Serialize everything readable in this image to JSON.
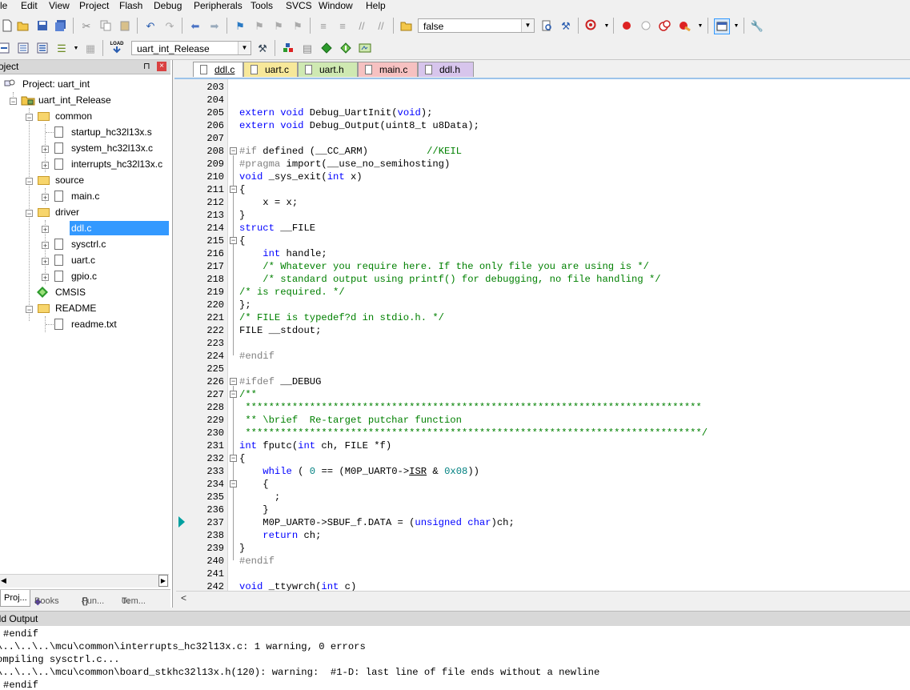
{
  "menu": [
    "le",
    "Edit",
    "View",
    "Project",
    "Flash",
    "Debug",
    "Peripherals",
    "Tools",
    "SVCS",
    "Window",
    "Help"
  ],
  "toolbar": {
    "find_value": "false",
    "target_value": "uart_int_Release",
    "load_label": "LOAD"
  },
  "project": {
    "panel_title": "oject",
    "items": [
      {
        "label": "Project: uart_int"
      },
      {
        "label": "uart_int_Release"
      },
      {
        "label": "common"
      },
      {
        "label": "startup_hc32l13x.s"
      },
      {
        "label": "system_hc32l13x.c"
      },
      {
        "label": "interrupts_hc32l13x.c"
      },
      {
        "label": "source"
      },
      {
        "label": "main.c"
      },
      {
        "label": "driver"
      },
      {
        "label": "ddl.c"
      },
      {
        "label": "sysctrl.c"
      },
      {
        "label": "uart.c"
      },
      {
        "label": "gpio.c"
      },
      {
        "label": "CMSIS"
      },
      {
        "label": "README"
      },
      {
        "label": "readme.txt"
      }
    ],
    "bottom_tabs": [
      "Proj...",
      "Books",
      "Fun...",
      "Tem..."
    ]
  },
  "editor": {
    "tabs": [
      {
        "label": "ddl.c",
        "color": "#ffffff"
      },
      {
        "label": "uart.c",
        "color": "#f7e89a"
      },
      {
        "label": "uart.h",
        "color": "#cfe9b2"
      },
      {
        "label": "main.c",
        "color": "#f6c1c1"
      },
      {
        "label": "ddl.h",
        "color": "#d7c5ec"
      }
    ],
    "line_numbers": [
      "203",
      "204",
      "205",
      "206",
      "207",
      "208",
      "209",
      "210",
      "211",
      "212",
      "213",
      "214",
      "215",
      "216",
      "217",
      "218",
      "219",
      "220",
      "221",
      "222",
      "223",
      "224",
      "225",
      "226",
      "227",
      "228",
      "229",
      "230",
      "231",
      "232",
      "233",
      "234",
      "235",
      "236",
      "237",
      "238",
      "239",
      "240",
      "241",
      "242"
    ]
  },
  "build_output": {
    "title": "ild Output",
    "lines": [
      "#endif",
      "\\..\\..\\..\\mcu\\common\\interrupts_hc32l13x.c: 1 warning, 0 errors",
      "ompiling sysctrl.c...",
      "\\..\\..\\..\\mcu\\common\\board_stkhc32l13x.h(120): warning:  #1-D: last line of file ends without a newline",
      "#endif"
    ]
  }
}
